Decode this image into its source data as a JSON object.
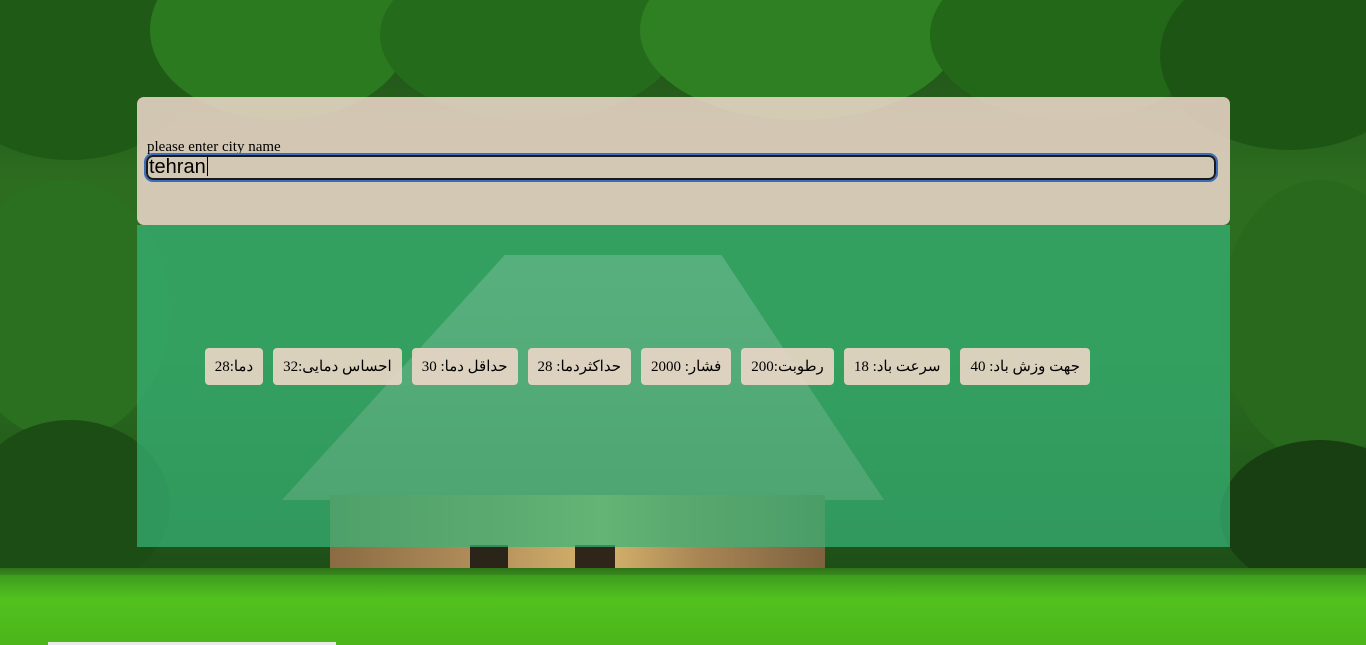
{
  "search": {
    "label": "please enter city name",
    "value": "tehran"
  },
  "weather": {
    "items": [
      "جهت وزش باد: 40",
      "سرعت باد: 18",
      "رطوبت:200",
      "فشار: 2000",
      "حداکثردما: 28",
      "حداقل دما: 30",
      "احساس دمایی:32",
      "دما:28"
    ]
  },
  "colors": {
    "search_card_bg": "#ead5c8",
    "results_panel_bg": "#38b478",
    "chip_bg": "#e8d5c6",
    "input_focus_ring": "#3b6db8"
  }
}
